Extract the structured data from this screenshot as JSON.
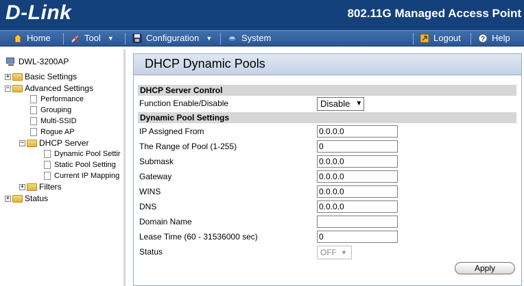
{
  "header": {
    "logo": "D-Link",
    "product": "802.11G Managed Access Point"
  },
  "menubar": {
    "home": "Home",
    "tool": "Tool",
    "configuration": "Configuration",
    "system": "System",
    "logout": "Logout",
    "help": "Help"
  },
  "tree": {
    "device": "DWL-3200AP",
    "basic_settings": "Basic Settings",
    "advanced_settings": "Advanced Settings",
    "performance": "Performance",
    "grouping": "Grouping",
    "multi_ssid": "Multi-SSID",
    "rogue_ap": "Rogue AP",
    "dhcp_server": "DHCP Server",
    "dynamic_pool": "Dynamic Pool Settir",
    "static_pool": "Static Pool Setting",
    "current_ip_mapping": "Current IP Mapping",
    "filters": "Filters",
    "status": "Status",
    "expand_plus": "+",
    "expand_minus": "−"
  },
  "panel": {
    "title": "DHCP Dynamic Pools",
    "section_server": "DHCP Server Control",
    "function_label": "Function Enable/Disable",
    "function_value": "Disable",
    "section_pool": "Dynamic Pool Settings",
    "fields": [
      {
        "label": "IP Assigned From",
        "value": "0.0.0.0"
      },
      {
        "label": "The Range of Pool (1-255)",
        "value": "0"
      },
      {
        "label": "Submask",
        "value": "0.0.0.0"
      },
      {
        "label": "Gateway",
        "value": "0.0.0.0"
      },
      {
        "label": "WINS",
        "value": "0.0.0.0"
      },
      {
        "label": "DNS",
        "value": "0.0.0.0"
      },
      {
        "label": "Domain Name",
        "value": ""
      },
      {
        "label": "Lease Time (60 - 31536000 sec)",
        "value": "0"
      }
    ],
    "status_label": "Status",
    "status_value": "OFF",
    "apply": "Apply",
    "dropdown_arrow": "▼"
  }
}
